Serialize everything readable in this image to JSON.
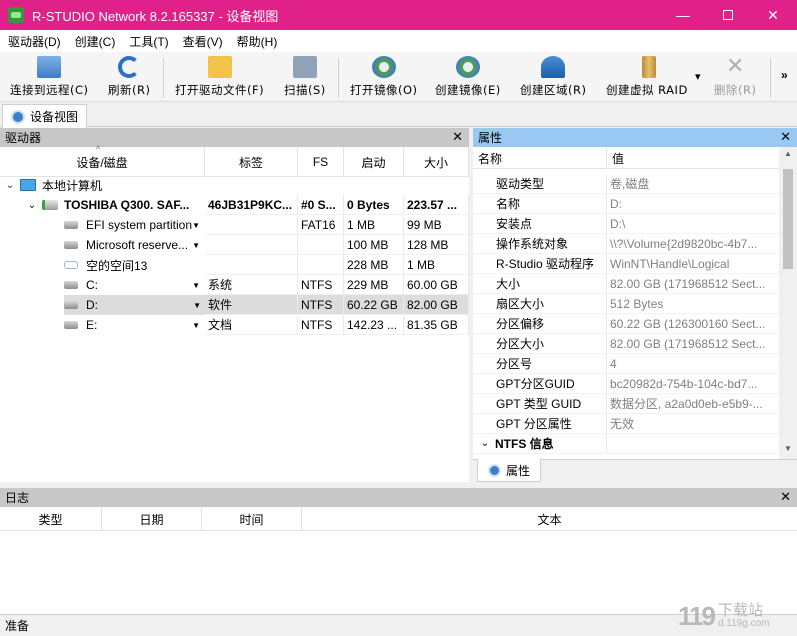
{
  "window": {
    "title": "R-STUDIO Network 8.2.165337 - 设备视图",
    "minimize": "—",
    "close": "✕"
  },
  "menu": [
    "驱动器(D)",
    "创建(C)",
    "工具(T)",
    "查看(V)",
    "帮助(H)"
  ],
  "toolbar": {
    "connect": "连接到远程(C)",
    "refresh": "刷新(R)",
    "open_drive_files": "打开驱动文件(F)",
    "scan": "扫描(S)",
    "open_image": "打开镜像(O)",
    "create_image": "创建镜像(E)",
    "create_region": "创建区域(R)",
    "create_raid": "创建虚拟 RAID",
    "raid_dropdown": "▾",
    "delete": "删除(R)",
    "overflow": "»"
  },
  "tabs": {
    "device_view": "设备视图"
  },
  "drives": {
    "panel_title": "驱动器",
    "close": "✕",
    "columns": {
      "device": "设备/磁盘",
      "label": "标签",
      "fs": "FS",
      "start": "启动",
      "size": "大小"
    },
    "rows": [
      {
        "name": "本地计算机",
        "label": "",
        "fs": "",
        "start": "",
        "size": ""
      },
      {
        "name": "TOSHIBA Q300. SAF...",
        "label": "46JB31P9KC...",
        "fs": "#0 S...",
        "start": "0 Bytes",
        "size": "223.57 ..."
      },
      {
        "name": "EFI system partition",
        "label": "",
        "fs": "FAT16",
        "start": "1 MB",
        "size": "99 MB"
      },
      {
        "name": "Microsoft reserve...",
        "label": "",
        "fs": "",
        "start": "100 MB",
        "size": "128 MB"
      },
      {
        "name": "空的空间13",
        "label": "",
        "fs": "",
        "start": "228 MB",
        "size": "1 MB"
      },
      {
        "name": "C:",
        "label": "系统",
        "fs": "NTFS",
        "start": "229 MB",
        "size": "60.00 GB"
      },
      {
        "name": "D:",
        "label": "软件",
        "fs": "NTFS",
        "start": "60.22 GB",
        "size": "82.00 GB"
      },
      {
        "name": "E:",
        "label": "文档",
        "fs": "NTFS",
        "start": "142.23 ...",
        "size": "81.35 GB"
      }
    ]
  },
  "properties": {
    "panel_title": "属性",
    "close": "✕",
    "columns": {
      "name": "名称",
      "value": "值"
    },
    "rows": [
      {
        "name": "驱动类型",
        "value": "卷,磁盘"
      },
      {
        "name": "名称",
        "value": "D:"
      },
      {
        "name": "安装点",
        "value": "D:\\"
      },
      {
        "name": "操作系统对象",
        "value": "\\\\?\\Volume{2d9820bc-4b7..."
      },
      {
        "name": "R-Studio 驱动程序",
        "value": "WinNT\\Handle\\Logical"
      },
      {
        "name": "大小",
        "value": "82.00 GB (171968512 Sect..."
      },
      {
        "name": "扇区大小",
        "value": "512 Bytes"
      },
      {
        "name": "分区偏移",
        "value": "60.22 GB (126300160 Sect..."
      },
      {
        "name": "分区大小",
        "value": "82.00 GB (171968512 Sect..."
      },
      {
        "name": "分区号",
        "value": "4"
      },
      {
        "name": "GPT分区GUID",
        "value": "bc20982d-754b-104c-bd7..."
      },
      {
        "name": "GPT 类型 GUID",
        "value": "数据分区, a2a0d0eb-e5b9-..."
      },
      {
        "name": "GPT 分区属性",
        "value": "无效"
      },
      {
        "name": "NTFS 信息",
        "value": ""
      }
    ],
    "tab": "属性"
  },
  "log": {
    "panel_title": "日志",
    "close": "✕",
    "columns": {
      "type": "类型",
      "date": "日期",
      "time": "时间",
      "text": "文本"
    }
  },
  "status": {
    "text": "准备"
  },
  "watermark": {
    "logo": "119",
    "text": "下载站",
    "sub": "d.119g.com"
  }
}
